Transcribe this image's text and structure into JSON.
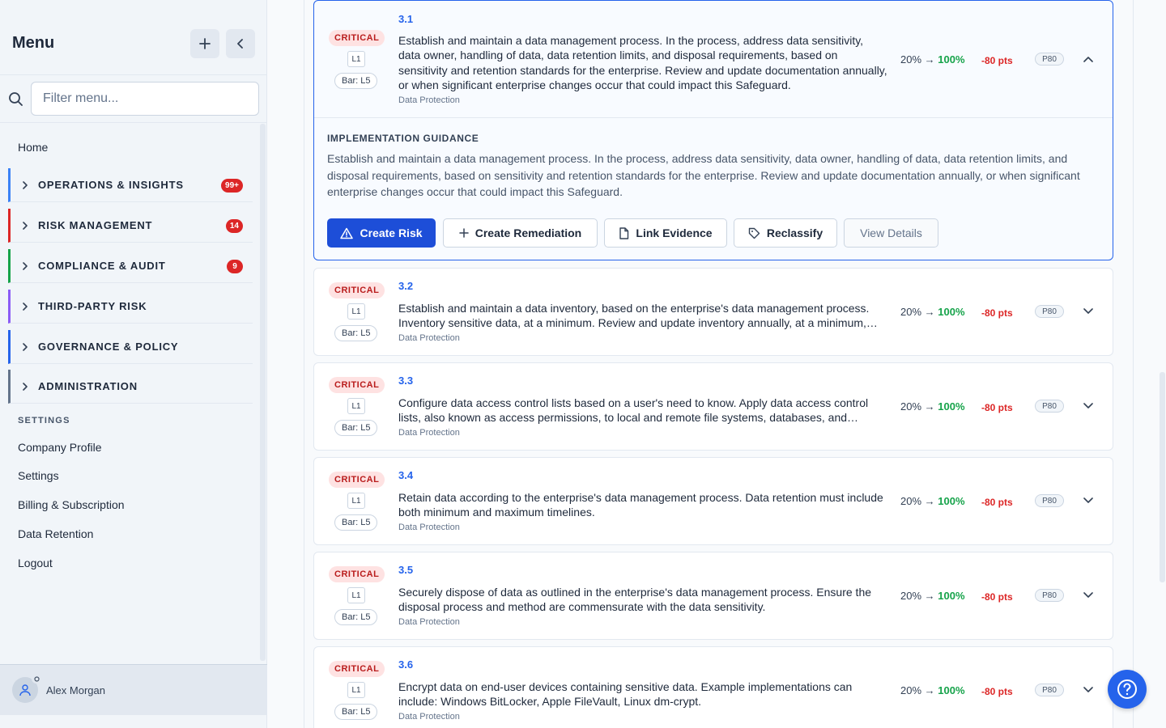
{
  "sidebar": {
    "title": "Menu",
    "filter_placeholder": "Filter menu...",
    "home": "Home",
    "sections": [
      {
        "label": "OPERATIONS & INSIGHTS",
        "badge": "99+",
        "color": "#3b82f6"
      },
      {
        "label": "RISK MANAGEMENT",
        "badge": "14",
        "color": "#dc2626"
      },
      {
        "label": "COMPLIANCE & AUDIT",
        "badge": "9",
        "color": "#16a34a"
      },
      {
        "label": "THIRD-PARTY RISK",
        "badge": "",
        "color": "#8b5cf6"
      },
      {
        "label": "GOVERNANCE & POLICY",
        "badge": "",
        "color": "#2563eb"
      },
      {
        "label": "ADMINISTRATION",
        "badge": "",
        "color": "#64748b"
      }
    ],
    "settings_heading": "SETTINGS",
    "settings_links": [
      "Company Profile",
      "Settings",
      "Billing & Subscription",
      "Data Retention",
      "Logout"
    ],
    "user_name": "Alex Morgan"
  },
  "safeguards": [
    {
      "severity": "CRITICAL",
      "level": "L1",
      "bar": "Bar: L5",
      "id": "3.1",
      "text": "Establish and maintain a data management process. In the process, address data sensitivity, data owner, handling of data, data retention limits, and disposal requirements, based on sensitivity and retention standards for the enterprise. Review and update documentation annually, or when significant enterprise changes occur that could impact this Safeguard.",
      "category": "Data Protection",
      "score_from": "20%",
      "arrow": "→",
      "score_to": "100%",
      "pts": "-80 pts",
      "priority": "P80"
    },
    {
      "severity": "CRITICAL",
      "level": "L1",
      "bar": "Bar: L5",
      "id": "3.2",
      "text": "Establish and maintain a data inventory, based on the enterprise's data management process. Inventory sensitive data, at a minimum. Review and update inventory annually, at a minimum, with a priority on sensitive data.",
      "category": "Data Protection",
      "score_from": "20%",
      "arrow": "→",
      "score_to": "100%",
      "pts": "-80 pts",
      "priority": "P80"
    },
    {
      "severity": "CRITICAL",
      "level": "L1",
      "bar": "Bar: L5",
      "id": "3.3",
      "text": "Configure data access control lists based on a user's need to know. Apply data access control lists, also known as access permissions, to local and remote file systems, databases, and applications.",
      "category": "Data Protection",
      "score_from": "20%",
      "arrow": "→",
      "score_to": "100%",
      "pts": "-80 pts",
      "priority": "P80"
    },
    {
      "severity": "CRITICAL",
      "level": "L1",
      "bar": "Bar: L5",
      "id": "3.4",
      "text": "Retain data according to the enterprise's data management process. Data retention must include both minimum and maximum timelines.",
      "category": "Data Protection",
      "score_from": "20%",
      "arrow": "→",
      "score_to": "100%",
      "pts": "-80 pts",
      "priority": "P80"
    },
    {
      "severity": "CRITICAL",
      "level": "L1",
      "bar": "Bar: L5",
      "id": "3.5",
      "text": "Securely dispose of data as outlined in the enterprise's data management process. Ensure the disposal process and method are commensurate with the data sensitivity.",
      "category": "Data Protection",
      "score_from": "20%",
      "arrow": "→",
      "score_to": "100%",
      "pts": "-80 pts",
      "priority": "P80"
    },
    {
      "severity": "CRITICAL",
      "level": "L1",
      "bar": "Bar: L5",
      "id": "3.6",
      "text": "Encrypt data on end-user devices containing sensitive data. Example implementations can include: Windows BitLocker, Apple FileVault, Linux dm-crypt.",
      "category": "Data Protection",
      "score_from": "20%",
      "arrow": "→",
      "score_to": "100%",
      "pts": "-80 pts",
      "priority": "P80"
    }
  ],
  "guidance": {
    "heading": "IMPLEMENTATION GUIDANCE",
    "text": "Establish and maintain a data management process. In the process, address data sensitivity, data owner, handling of data, data retention limits, and disposal requirements, based on sensitivity and retention standards for the enterprise. Review and update documentation annually, or when significant enterprise changes occur that could impact this Safeguard."
  },
  "actions": {
    "create_risk": "Create Risk",
    "create_remediation": "Create Remediation",
    "link_evidence": "Link Evidence",
    "reclassify": "Reclassify",
    "view_details": "View Details"
  },
  "icons": {
    "add": "plus-icon",
    "collapse": "chevron-left-icon",
    "search": "search-icon",
    "help": "help-circle-icon",
    "user": "user-icon"
  }
}
